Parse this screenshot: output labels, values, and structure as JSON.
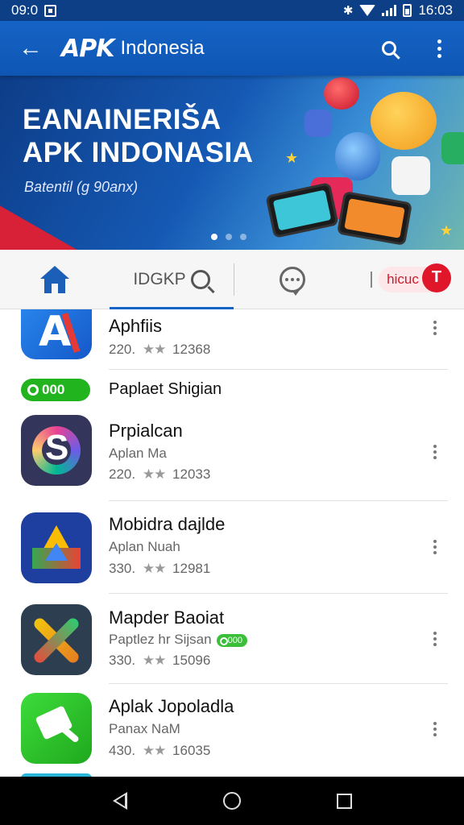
{
  "status_bar": {
    "time_left": "09:0",
    "time_right": "16:03"
  },
  "app_bar": {
    "logo_text": "APK",
    "title": "Indonesia"
  },
  "banner": {
    "title_line1": "EANAINERIŠA",
    "title_line2": "APK INDONASIA",
    "subtitle": "Batentil (g 90anx)",
    "pager": {
      "count": 3,
      "active_index": 0
    }
  },
  "tabs": {
    "search_label": "IDGKP",
    "hot_label": "hicuc",
    "hot_badge": "T",
    "active": "search"
  },
  "section": {
    "badge": "000",
    "label": "Paplaet Shigian"
  },
  "apps": [
    {
      "name": "Aphfiis",
      "sub": "",
      "downloads": "220.",
      "rating_stars": "★★",
      "size": "12368",
      "icon": "letter-a-app-icon",
      "colors": [
        "#1a73e8",
        "#e53935"
      ]
    },
    {
      "name": "Prpialcan",
      "sub": "Aplan Ma",
      "downloads": "220.",
      "rating_stars": "★★",
      "size": "12033",
      "icon": "swirl-s-app-icon",
      "colors": [
        "#3a2a6b",
        "#e84393"
      ]
    },
    {
      "name": "Mobidra dajlde",
      "sub": "Aplan Nuah",
      "downloads": "330.",
      "rating_stars": "★★",
      "size": "12981",
      "icon": "triangle-drive-app-icon",
      "colors": [
        "#1e3fa0",
        "#fbbc04"
      ]
    },
    {
      "name": "Mapder Baoiat",
      "sub": "Paptlez hr Sijsan",
      "sub_badge": "000",
      "downloads": "330.",
      "rating_stars": "★★",
      "size": "15096",
      "icon": "crossed-tools-app-icon",
      "colors": [
        "#2c3e50",
        "#f1c40f"
      ]
    },
    {
      "name": "Aplak Jopoladla",
      "sub": "Panax NaM",
      "downloads": "430.",
      "rating_stars": "★★",
      "size": "16035",
      "icon": "green-hammer-app-icon",
      "colors": [
        "#2ecc40",
        "#ffffff"
      ]
    }
  ]
}
